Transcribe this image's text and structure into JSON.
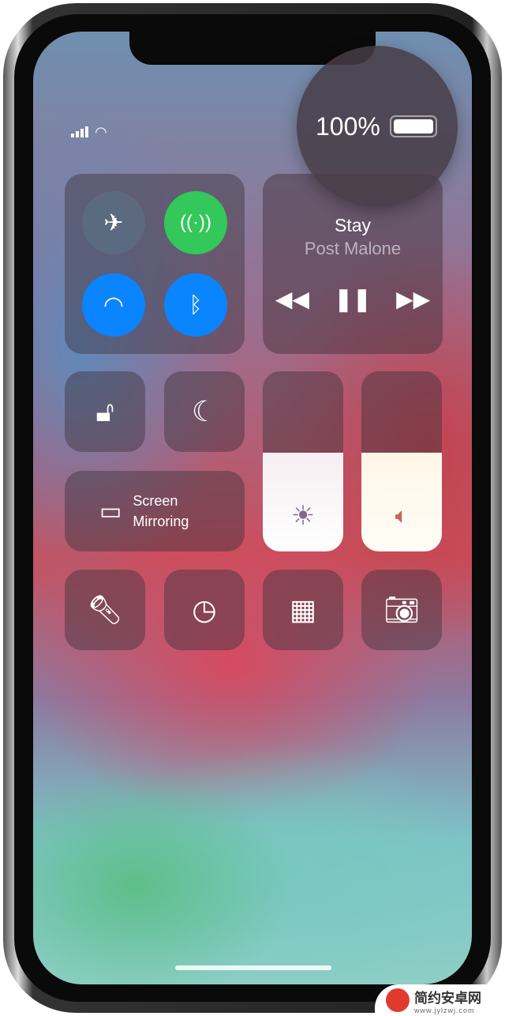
{
  "status": {
    "battery": "100%",
    "signal_icon": "cellular-signal-icon",
    "wifi_icon": "wifi-icon"
  },
  "connectivity": {
    "airplane": "airplane-icon",
    "cellular": "antenna-icon",
    "wifi": "wifi-icon",
    "bluetooth": "bluetooth-icon",
    "colors": {
      "cellular": "#34c759",
      "wifi": "#0a84ff",
      "bluetooth": "#0a84ff"
    }
  },
  "music": {
    "title": "Stay",
    "artist": "Post Malone"
  },
  "screen_mirroring": {
    "line1": "Screen",
    "line2": "Mirroring"
  },
  "brightness_level": 0.55,
  "volume_level": 0.55,
  "watermark": {
    "name": "简约安卓网",
    "url": "www.jylzwj.com"
  }
}
